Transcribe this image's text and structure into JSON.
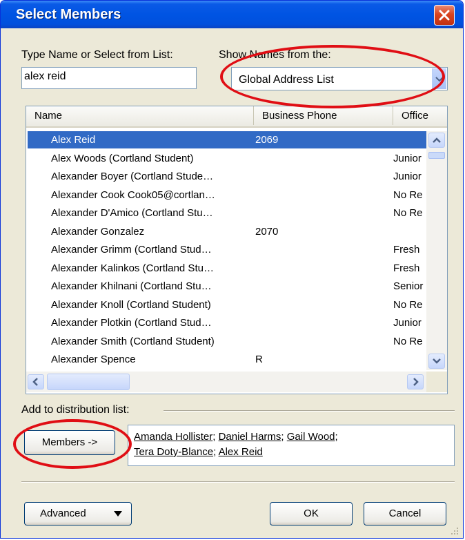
{
  "window": {
    "title": "Select Members"
  },
  "search": {
    "label": "Type Name or Select from List:",
    "value": "alex reid"
  },
  "address_book": {
    "label": "Show Names from the:",
    "selected": "Global Address List"
  },
  "list": {
    "columns": [
      "Name",
      "Business Phone",
      "Office"
    ],
    "rows": [
      {
        "name": "Alex Reid",
        "phone": "2069",
        "office": "",
        "selected": true
      },
      {
        "name": "Alex Woods (Cortland Student)",
        "phone": "",
        "office": "Junior"
      },
      {
        "name": "Alexander Boyer (Cortland Stude…",
        "phone": "",
        "office": "Junior"
      },
      {
        "name": "Alexander Cook Cook05@cortlan…",
        "phone": "",
        "office": "No Re"
      },
      {
        "name": "Alexander D'Amico (Cortland Stu…",
        "phone": "",
        "office": "No Re"
      },
      {
        "name": "Alexander Gonzalez",
        "phone": "2070",
        "office": ""
      },
      {
        "name": "Alexander Grimm (Cortland Stud…",
        "phone": "",
        "office": "Fresh"
      },
      {
        "name": "Alexander Kalinkos (Cortland Stu…",
        "phone": "",
        "office": "Fresh"
      },
      {
        "name": "Alexander Khilnani (Cortland Stu…",
        "phone": "",
        "office": "Senior"
      },
      {
        "name": "Alexander Knoll (Cortland Student)",
        "phone": "",
        "office": "No Re"
      },
      {
        "name": "Alexander Plotkin (Cortland Stud…",
        "phone": "",
        "office": "Junior"
      },
      {
        "name": "Alexander Smith (Cortland Student)",
        "phone": "",
        "office": "No Re"
      },
      {
        "name": "Alexander Spence",
        "phone": "R",
        "office": ""
      }
    ]
  },
  "distribution": {
    "label": "Add to distribution list:",
    "members_button": "Members ->",
    "members": [
      "Amanda Hollister",
      "Daniel Harms",
      "Gail Wood",
      "Tera Doty-Blance",
      "Alex Reid"
    ]
  },
  "footer": {
    "advanced": "Advanced",
    "ok": "OK",
    "cancel": "Cancel"
  },
  "colors": {
    "selection": "#316ac5",
    "annotation": "#e00e14",
    "titlebar": "#0054e3"
  },
  "icons": [
    "close-icon",
    "dropdown-arrow-icon",
    "scroll-up-icon",
    "scroll-down-icon",
    "scroll-left-icon",
    "scroll-right-icon",
    "resize-grip-icon"
  ]
}
